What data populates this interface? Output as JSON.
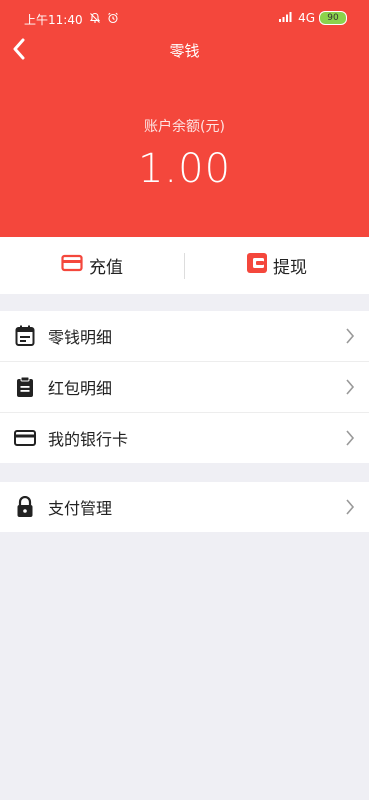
{
  "status": {
    "time": "上午11:40",
    "network": "4G",
    "battery": "90"
  },
  "header": {
    "title": "零钱"
  },
  "balance": {
    "label": "账户余额(元)",
    "value": "1.00"
  },
  "actions": {
    "recharge": "充值",
    "withdraw": "提现"
  },
  "menu": [
    {
      "label": "零钱明细"
    },
    {
      "label": "红包明细"
    },
    {
      "label": "我的银行卡"
    }
  ],
  "menu2": [
    {
      "label": "支付管理"
    }
  ],
  "colors": {
    "brand": "#f4473c",
    "icon": "#222222"
  }
}
